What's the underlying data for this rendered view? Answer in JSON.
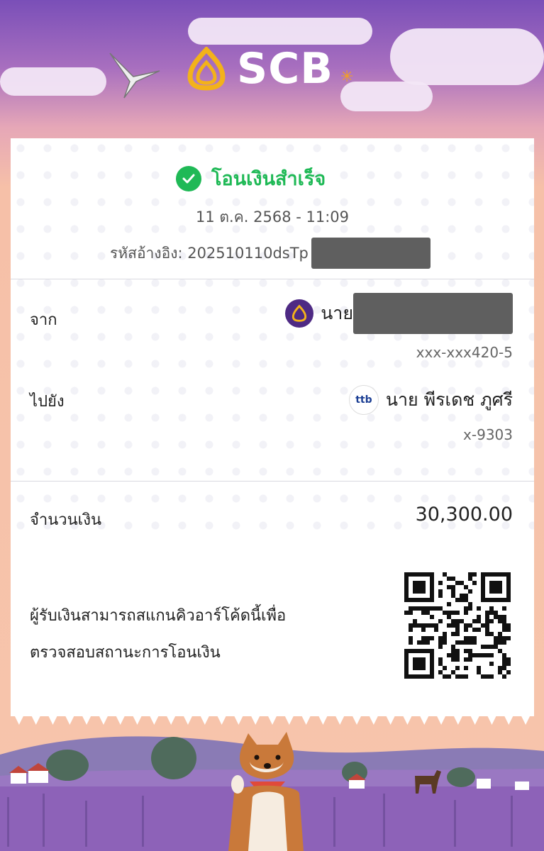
{
  "header": {
    "brand": "SCB"
  },
  "status": {
    "text": "โอนเงินสำเร็จ"
  },
  "transaction": {
    "datetime": "11 ต.ค. 2568 - 11:09",
    "ref_label": "รหัสอ้างอิง: 202510110dsTp"
  },
  "from": {
    "label": "จาก",
    "name_prefix": "นาย",
    "account": "xxx-xxx420-5"
  },
  "to": {
    "label": "ไปยัง",
    "name": "นาย พีรเดช ภูศรี",
    "account": "x-9303",
    "bank_icon_text": "ttb"
  },
  "amount": {
    "label": "จำนวนเงิน",
    "value": "30,300.00"
  },
  "qr": {
    "line1": "ผู้รับเงินสามารถสแกนคิวอาร์โค้ดนี้เพื่อ",
    "line2": "ตรวจสอบสถานะการโอนเงิน"
  },
  "colors": {
    "success": "#1fb956",
    "scb_purple": "#4e2a84",
    "redaction": "#5f5f5f"
  }
}
